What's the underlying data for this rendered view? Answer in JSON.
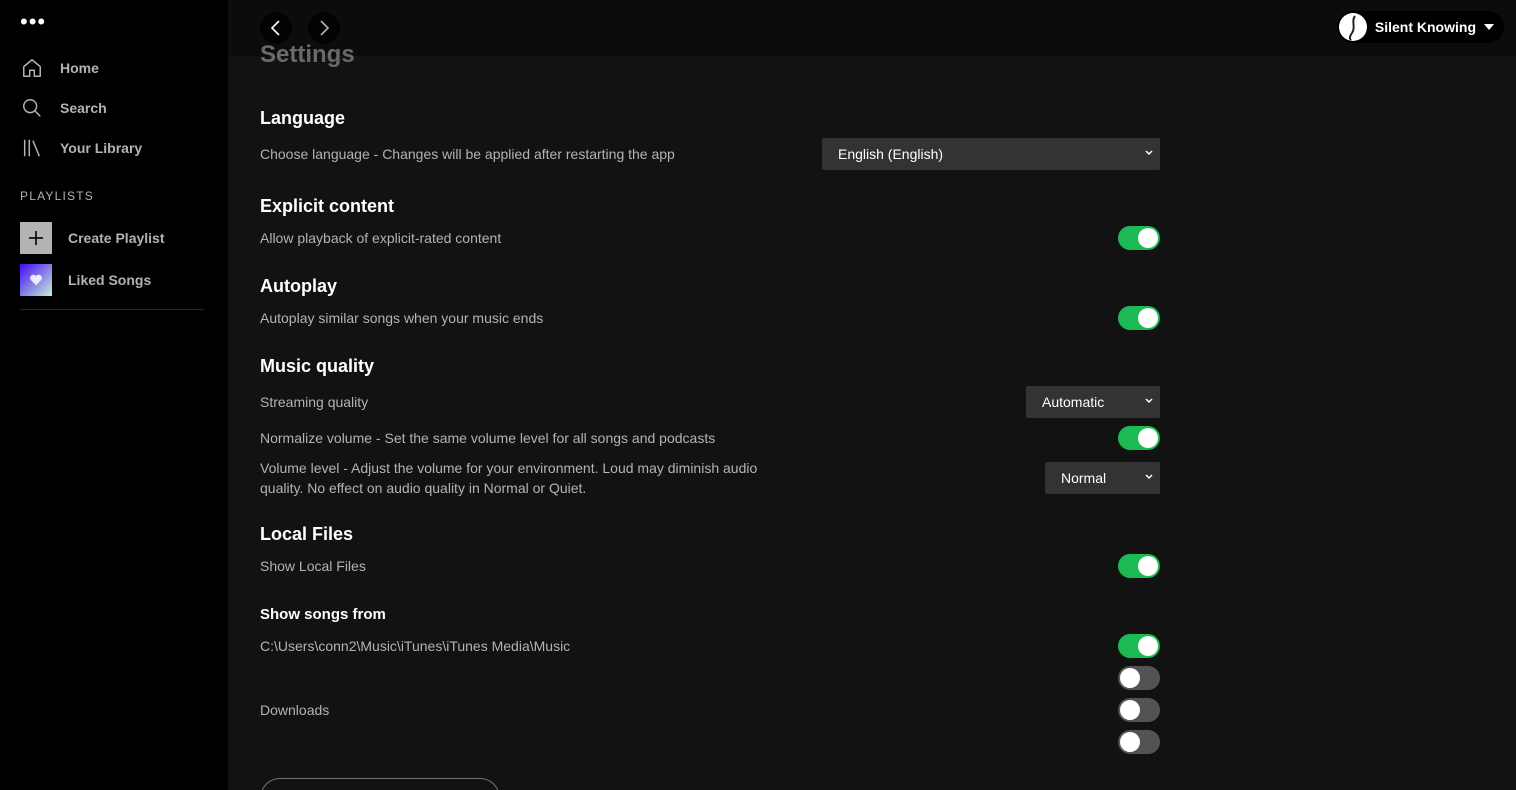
{
  "sidebar": {
    "menu": "•••",
    "nav": [
      {
        "label": "Home",
        "icon": "home-icon"
      },
      {
        "label": "Search",
        "icon": "search-icon"
      },
      {
        "label": "Your Library",
        "icon": "library-icon"
      }
    ],
    "playlists_title": "PLAYLISTS",
    "create_playlist": "Create Playlist",
    "liked_songs": "Liked Songs"
  },
  "topbar": {
    "user_name": "Silent Knowing"
  },
  "settings": {
    "title": "Settings",
    "language": {
      "heading": "Language",
      "label": "Choose language - Changes will be applied after restarting the app",
      "value": "English (English)"
    },
    "explicit": {
      "heading": "Explicit content",
      "label": "Allow playback of explicit-rated content",
      "enabled": true
    },
    "autoplay": {
      "heading": "Autoplay",
      "label": "Autoplay similar songs when your music ends",
      "enabled": true
    },
    "music_quality": {
      "heading": "Music quality",
      "streaming_label": "Streaming quality",
      "streaming_value": "Automatic",
      "normalize_label": "Normalize volume - Set the same volume level for all songs and podcasts",
      "normalize_enabled": true,
      "volume_label_line1": "Volume level - Adjust the volume for your environment. Loud may diminish audio",
      "volume_label_line2": "quality. No effect on audio quality in Normal or Quiet.",
      "volume_value": "Normal"
    },
    "local_files": {
      "heading": "Local Files",
      "label": "Show Local Files",
      "enabled": true
    },
    "show_songs_from": {
      "heading": "Show songs from",
      "sources": [
        {
          "label": "C:\\Users\\conn2\\Music\\iTunes\\iTunes Media\\Music",
          "enabled": true
        },
        {
          "label": "",
          "enabled": false
        },
        {
          "label": "Downloads",
          "enabled": false
        },
        {
          "label": "",
          "enabled": false
        }
      ]
    }
  },
  "colors": {
    "accent": "#1db954",
    "background": "#121212",
    "sidebar": "#000000"
  }
}
